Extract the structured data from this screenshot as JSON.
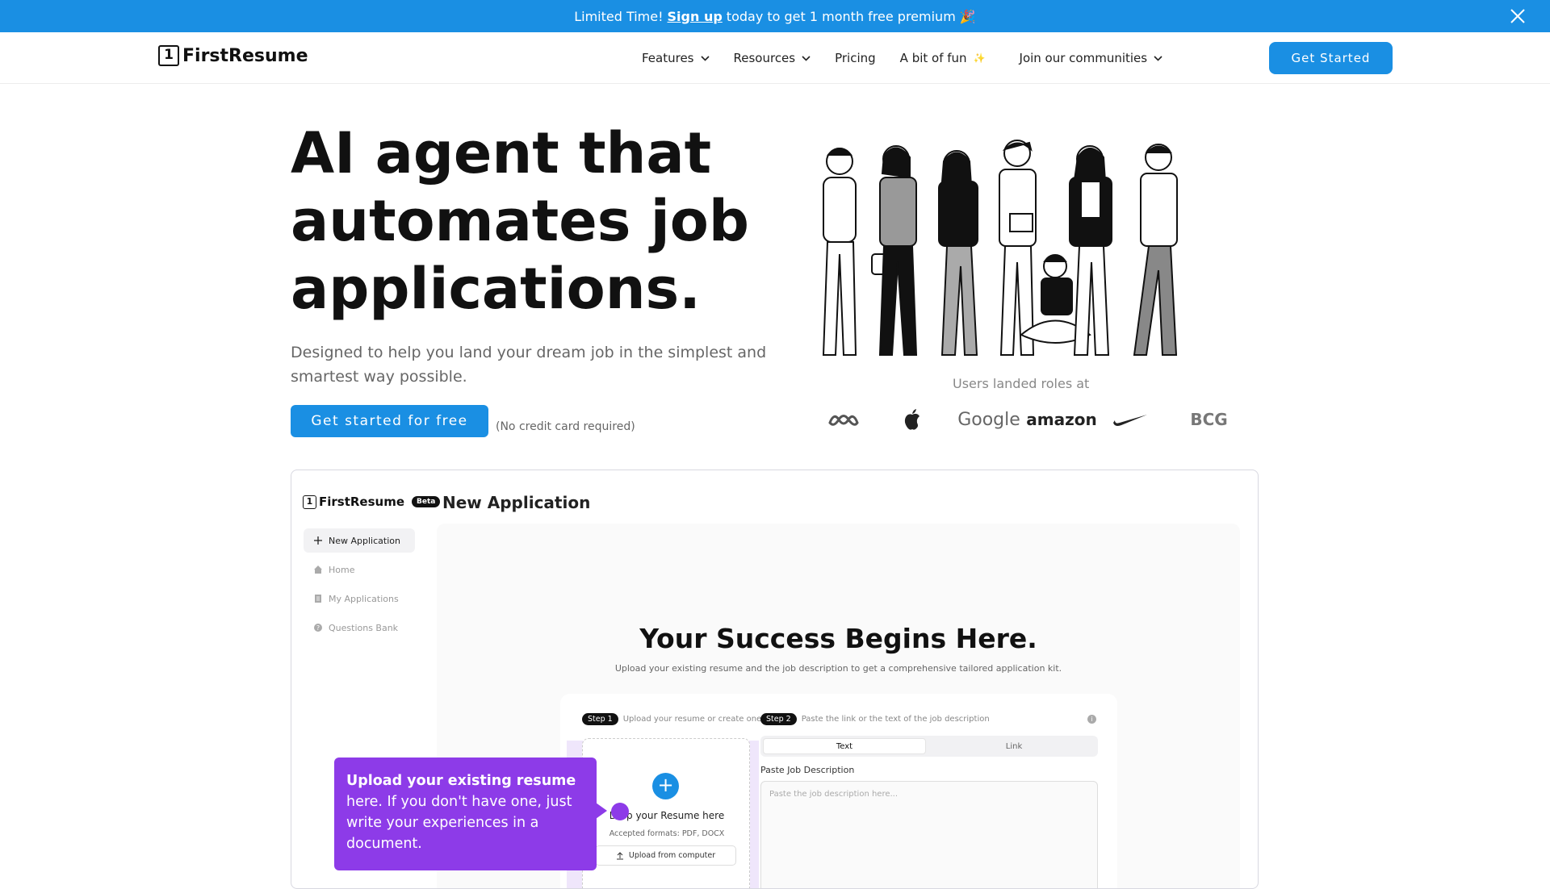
{
  "banner": {
    "prefix": "Limited Time!",
    "signup": "Sign up",
    "suffix": "today to get 1 month free premium 🎉"
  },
  "nav": {
    "logo_digit": "1",
    "logo_text": "FirstResume",
    "items": [
      {
        "label": "Features",
        "dropdown": true
      },
      {
        "label": "Resources",
        "dropdown": true
      },
      {
        "label": "Pricing",
        "dropdown": false
      },
      {
        "label": "A bit of fun",
        "emoji": "✨",
        "dropdown": false
      },
      {
        "label": "Join our communities",
        "dropdown": true
      }
    ],
    "cta": "Get Started"
  },
  "hero": {
    "title": "AI agent that automates job applications.",
    "subtitle": "Designed to help you land your dream job in the simplest and smartest way possible.",
    "cta": "Get started for free",
    "cta_note": "(No credit card required)",
    "landed": "Users landed roles at",
    "brands": [
      "meta-logo",
      "apple-logo",
      "Google",
      "amazon",
      "nike-logo",
      "BCG"
    ]
  },
  "app": {
    "logo_digit": "1",
    "logo_text": "FirstResume",
    "beta": "Beta",
    "heading": "New Application",
    "sidebar": [
      {
        "label": "New Application",
        "icon": "plus-icon"
      },
      {
        "label": "Home",
        "icon": "home-icon"
      },
      {
        "label": "My Applications",
        "icon": "document-icon"
      },
      {
        "label": "Questions Bank",
        "icon": "question-icon"
      }
    ],
    "success_title": "Your Success Begins Here.",
    "success_sub": "Upload your existing resume and the job description to get a comprehensive tailored application kit.",
    "step1_pill": "Step 1",
    "step1_text": "Upload your resume or create one",
    "step2_pill": "Step 2",
    "step2_text": "Paste the link or the text of the job description",
    "drop_text": "Drop your Resume here",
    "accepted": "Accepted formats: PDF, DOCX",
    "upload_btn": "Upload from computer",
    "tabs": [
      "Text",
      "Link"
    ],
    "paste_label": "Paste Job Description",
    "paste_placeholder": "Paste the job description here...",
    "tooltip_bold": "Upload your existing resume",
    "tooltip_rest": "here. If you don't have one, just write your experiences in a document."
  },
  "colors": {
    "accent": "#1a8fe3",
    "tooltip": "#8d3be8"
  }
}
